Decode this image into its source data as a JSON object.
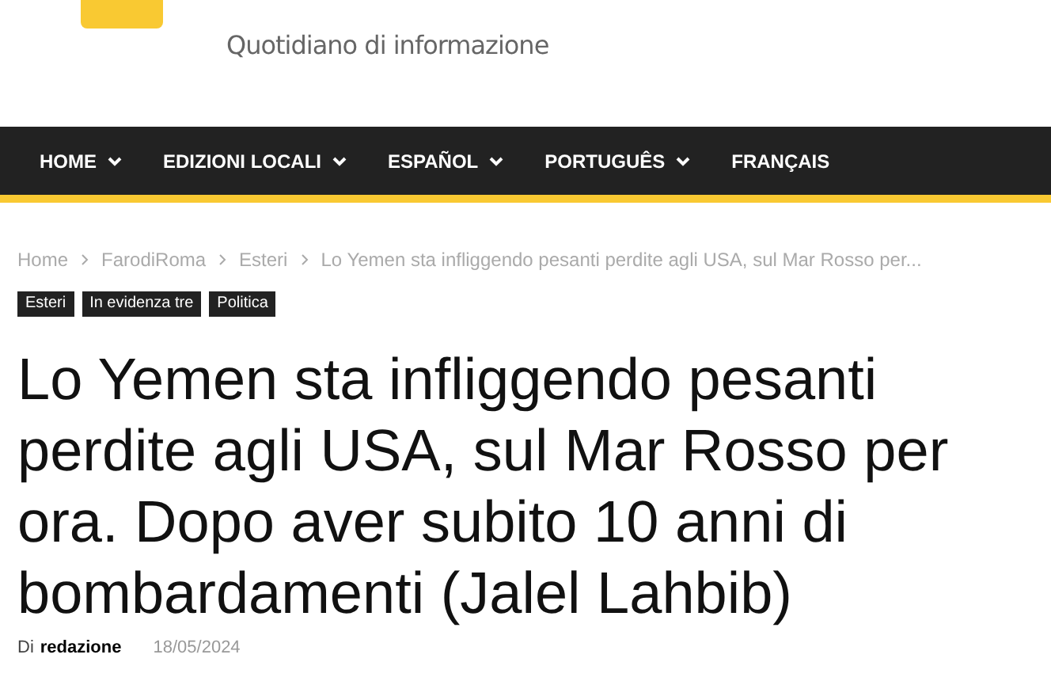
{
  "header": {
    "tagline": "Quotidiano di informazione"
  },
  "nav": [
    {
      "label": "HOME",
      "has_dropdown": true
    },
    {
      "label": "EDIZIONI LOCALI",
      "has_dropdown": true
    },
    {
      "label": "ESPAÑOL",
      "has_dropdown": true
    },
    {
      "label": "PORTUGUÊS",
      "has_dropdown": true
    },
    {
      "label": "FRANÇAIS",
      "has_dropdown": false
    }
  ],
  "breadcrumb": [
    "Home",
    "FarodiRoma",
    "Esteri",
    "Lo Yemen sta infliggendo pesanti perdite agli USA, sul Mar Rosso per..."
  ],
  "tags": [
    "Esteri",
    "In evidenza tre",
    "Politica"
  ],
  "headline": "Lo Yemen sta infliggendo pesanti perdite agli USA, sul Mar Rosso per ora. Dopo aver subito 10 anni di bombardamenti (Jalel Lahbib)",
  "byline": {
    "prefix": "Di",
    "author": "redazione",
    "date": "18/05/2024"
  }
}
